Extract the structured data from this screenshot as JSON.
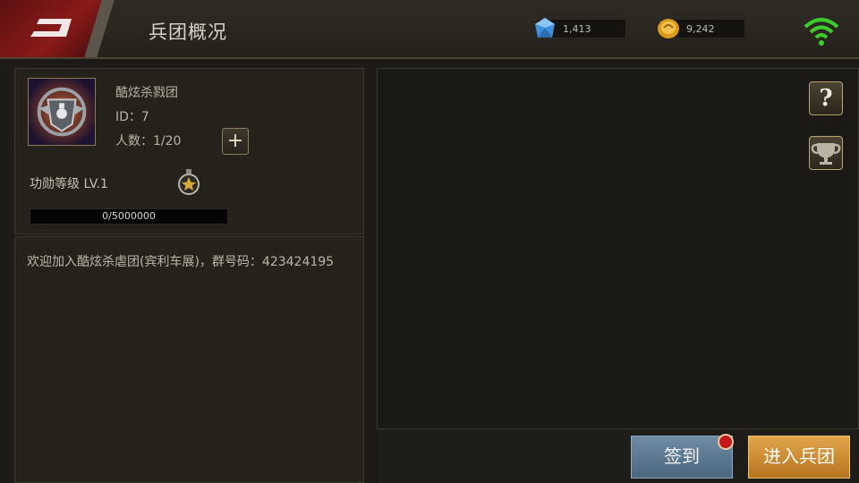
{
  "header": {
    "title": "兵团概况",
    "diamonds": "1,413",
    "gold": "9,242"
  },
  "guild": {
    "name": "酷炫杀戮团",
    "id_text": "ID：7",
    "members_text": "人数：1/20",
    "merit_label": "功勋等级  LV.1",
    "xp_text": "0/5000000",
    "xp_progress": 0
  },
  "notice": {
    "text": "欢迎加入酷炫杀虐团(宾利车展)，群号码：423424195"
  },
  "buttons": {
    "help": "?",
    "signin": "签到",
    "enter": "进入兵团"
  },
  "colors": {
    "back_button": "#8a1a1a",
    "signin_button": "#5f7c96",
    "enter_button": "#d0923a",
    "wifi": "#3ccc2e",
    "notification_badge": "#c41a1a"
  },
  "icons": {
    "back": "back-arrow-icon",
    "diamond": "diamond-icon",
    "gold": "gold-coin-icon",
    "wifi": "wifi-signal-icon",
    "medal": "medal-star-icon",
    "help": "question-icon",
    "trophy": "trophy-icon",
    "emblem": "guild-emblem-icon",
    "add": "plus-icon"
  }
}
